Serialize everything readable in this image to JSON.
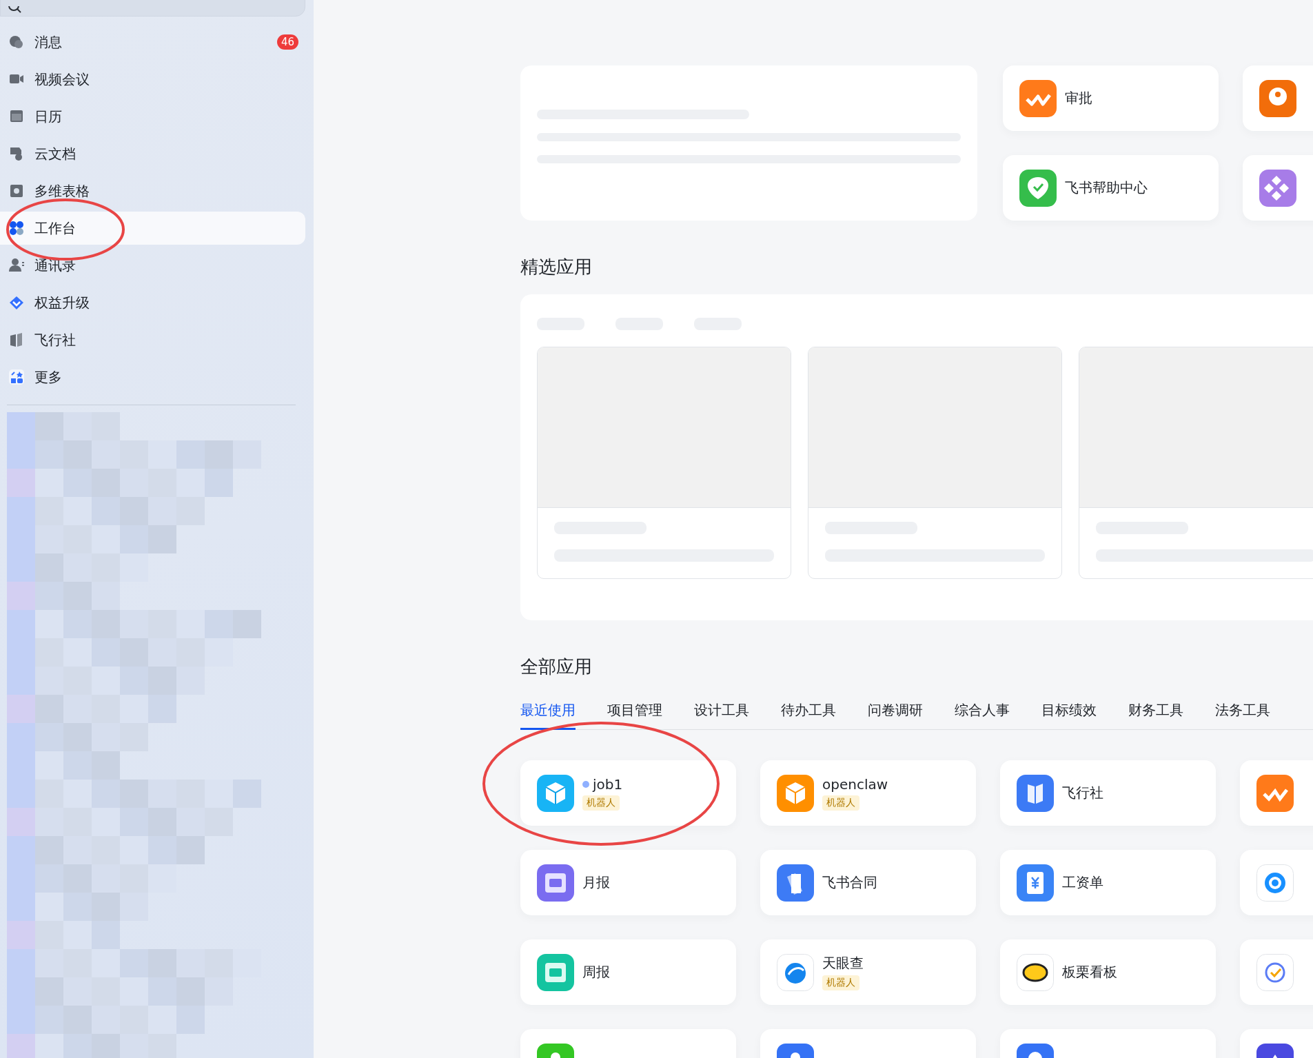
{
  "sidebar": {
    "search": {
      "kind": "search"
    },
    "nav_items": [
      {
        "label": "消息",
        "badge": "46",
        "selected": false
      },
      {
        "label": "视频会议",
        "selected": false
      },
      {
        "label": "日历",
        "selected": false
      },
      {
        "label": "云文档",
        "selected": false
      },
      {
        "label": "多维表格",
        "selected": false
      },
      {
        "label": "工作台",
        "selected": true
      },
      {
        "label": "通讯录",
        "selected": false
      },
      {
        "label": "权益升级",
        "selected": false
      },
      {
        "label": "飞行社",
        "selected": false
      },
      {
        "label": "更多",
        "selected": false
      }
    ]
  },
  "pinned_apps": [
    {
      "kind": "app",
      "label": "审批"
    },
    {
      "kind": "partial"
    },
    {
      "kind": "app",
      "label": "飞书帮助中心"
    },
    {
      "kind": "partial"
    }
  ],
  "featured": {
    "title": "精选应用"
  },
  "all_apps": {
    "title": "全部应用",
    "tabs": [
      {
        "label": "最近使用",
        "selected": true
      },
      {
        "label": "项目管理",
        "selected": false
      },
      {
        "label": "设计工具",
        "selected": false
      },
      {
        "label": "待办工具",
        "selected": false
      },
      {
        "label": "问卷调研",
        "selected": false
      },
      {
        "label": "综合人事",
        "selected": false
      },
      {
        "label": "目标绩效",
        "selected": false
      },
      {
        "label": "财务工具",
        "selected": false
      },
      {
        "label": "法务工具",
        "selected": false
      }
    ],
    "apps": [
      {
        "kind": "app",
        "label": "job1",
        "tag": "机器人",
        "dot": true
      },
      {
        "kind": "app",
        "label": "openclaw",
        "tag": "机器人",
        "dot": false
      },
      {
        "kind": "app",
        "label": "飞行社",
        "dot": false
      },
      {
        "kind": "partial"
      },
      {
        "kind": "app",
        "label": "月报",
        "dot": false
      },
      {
        "kind": "app",
        "label": "飞书合同",
        "dot": false
      },
      {
        "kind": "app",
        "label": "工资单",
        "dot": false
      },
      {
        "kind": "partial"
      },
      {
        "kind": "app",
        "label": "周报",
        "dot": false
      },
      {
        "kind": "app",
        "label": "天眼查",
        "tag": "机器人",
        "dot": false
      },
      {
        "kind": "app",
        "label": "板栗看板",
        "dot": false
      },
      {
        "kind": "partial"
      },
      {
        "kind": "partial"
      },
      {
        "kind": "partial"
      },
      {
        "kind": "partial"
      },
      {
        "kind": "partial"
      }
    ]
  }
}
